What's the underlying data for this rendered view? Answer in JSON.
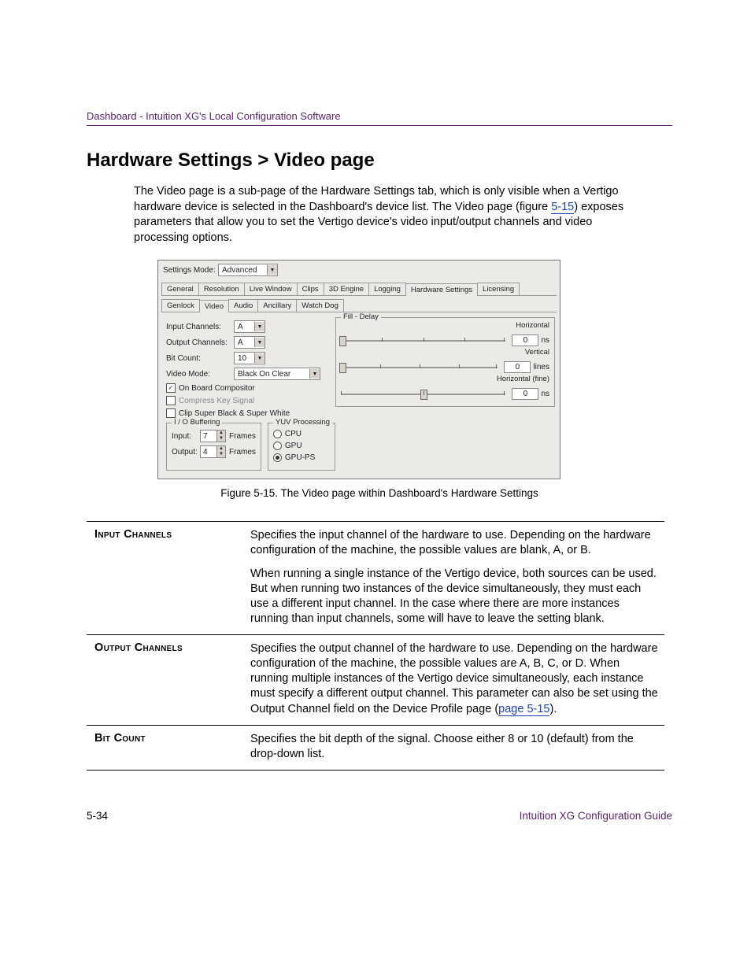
{
  "header": "Dashboard - Intuition XG's Local Configuration Software",
  "title": "Hardware Settings > Video page",
  "intro_pre": "The Video page is a sub-page of the Hardware Settings tab, which is only visible when a Vertigo hardware device is selected in the Dashboard's device list. The Video page (figure ",
  "intro_link": "5-15",
  "intro_post": ") exposes parameters that allow you to set the Vertigo device's video input/output channels and video processing options.",
  "screenshot": {
    "settings_mode_label": "Settings Mode:",
    "settings_mode_value": "Advanced",
    "tabs": [
      "General",
      "Resolution",
      "Live Window",
      "Clips",
      "3D Engine",
      "Logging",
      "Hardware Settings",
      "Licensing"
    ],
    "active_tab": "Hardware Settings",
    "subtabs": [
      "Genlock",
      "Video",
      "Audio",
      "Ancillary",
      "Watch Dog"
    ],
    "active_subtab": "Video",
    "left": {
      "input_channels_label": "Input Channels:",
      "input_channels_value": "A",
      "output_channels_label": "Output Channels:",
      "output_channels_value": "A",
      "bit_count_label": "Bit Count:",
      "bit_count_value": "10",
      "video_mode_label": "Video Mode:",
      "video_mode_value": "Black On Clear",
      "onboard_label": "On Board Compositor",
      "compress_label": "Compress Key Signal",
      "clip_label": "Clip Super Black & Super White",
      "io_group": "I / O Buffering",
      "io_input_label": "Input:",
      "io_input_value": "7",
      "io_output_label": "Output:",
      "io_output_value": "4",
      "io_frames": "Frames",
      "yuv_group": "YUV Processing",
      "yuv_cpu": "CPU",
      "yuv_gpu": "GPU",
      "yuv_gpups": "GPU-PS"
    },
    "right": {
      "fill_delay": "Fill - Delay",
      "horizontal_label": "Horizontal",
      "vertical_label": "Vertical",
      "horizontal_fine_label": "Horizontal (fine)",
      "zero": "0",
      "ns": "ns",
      "lines": "lines"
    }
  },
  "figure_caption": "Figure 5-15. The Video page within Dashboard's Hardware Settings",
  "table": {
    "input_channels": {
      "name": "Input Channels",
      "p1": "Specifies the input channel of the hardware to use. Depending on the hardware configuration of the machine, the possible values are blank, A, or B.",
      "p2": "When running a single instance of the Vertigo device, both sources can be used. But when running two instances of the device simultaneously, they must each use a different input channel. In the case where there are more instances running than input channels, some will have to leave the setting blank."
    },
    "output_channels": {
      "name": "Output Channels",
      "p1_pre": "Specifies the output channel of the hardware to use. Depending on the hardware configuration of the machine, the possible values are A, B, C, or D. When running multiple instances of the Vertigo device simultaneously, each instance must specify a different output channel. This parameter can also be set using the Output Channel field on the Device Profile page (",
      "p1_link": "page 5-15",
      "p1_post": ")."
    },
    "bit_count": {
      "name": "Bit Count",
      "p1": "Specifies the bit depth of the signal. Choose either 8 or 10 (default) from the drop-down list."
    }
  },
  "footer": {
    "left": "5-34",
    "right": "Intuition XG Configuration Guide"
  }
}
